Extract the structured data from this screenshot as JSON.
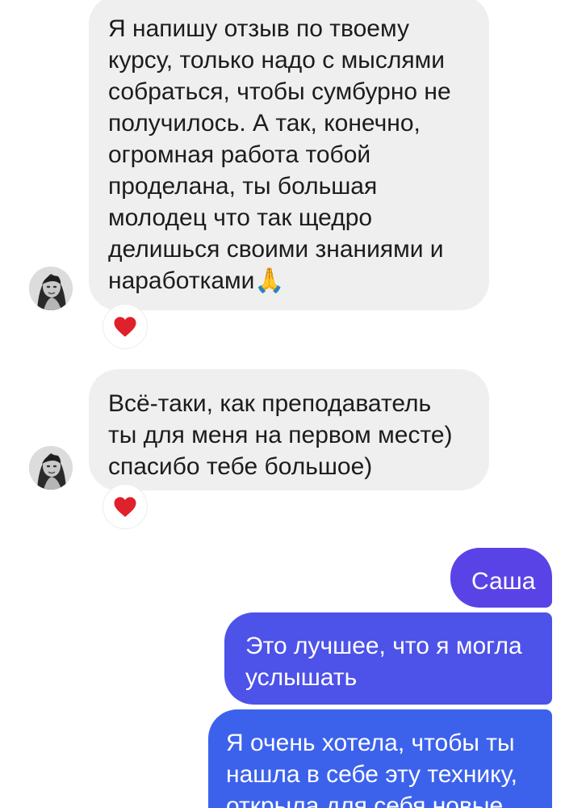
{
  "messages": [
    {
      "direction": "incoming",
      "text": "Я напишу отзыв по твоему\nкурсу, только надо с мыслями\nсобраться, чтобы сумбурно не\nполучилось. А так, конечно,\nогромная работа тобой\nпроделана, ты большая\nмолодец что так щедро\nделишься своими знаниями и\nнаработками",
      "emoji": "🙏",
      "reaction": "heart-icon"
    },
    {
      "direction": "incoming",
      "text": "Всё-таки, как преподаватель\nты для меня на первом месте)\nспасибо тебе большое)",
      "reaction": "heart-icon"
    },
    {
      "direction": "outgoing",
      "text": "Саша"
    },
    {
      "direction": "outgoing",
      "text": "Это лучшее, что я могла\nуслышать"
    },
    {
      "direction": "outgoing",
      "text": "Я очень хотела, чтобы ты\nнашла в себе эту технику,\nоткрыла для себя новые"
    }
  ],
  "colors": {
    "incoming_bubble": "#efefef",
    "outgoing_bubble_top": "#5a43e6",
    "outgoing_bubble_mid": "#4d52e8",
    "outgoing_bubble_bottom": "#3c62ec",
    "reaction_heart": "#e0202a"
  }
}
